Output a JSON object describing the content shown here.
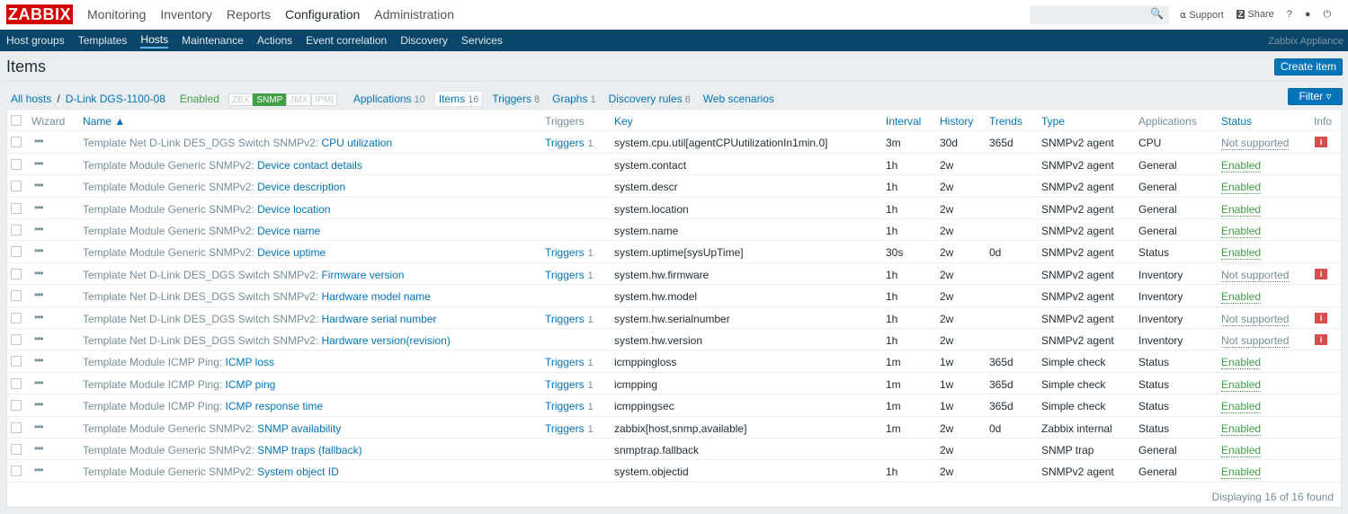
{
  "brand": "ZABBIX",
  "main_menu": [
    "Monitoring",
    "Inventory",
    "Reports",
    "Configuration",
    "Administration"
  ],
  "main_menu_active": 3,
  "top_links": {
    "support": "Support",
    "share": "Share",
    "help": "?"
  },
  "sub_menu": [
    "Host groups",
    "Templates",
    "Hosts",
    "Maintenance",
    "Actions",
    "Event correlation",
    "Discovery",
    "Services"
  ],
  "sub_menu_active": 2,
  "appliance": "Zabbix Appliance",
  "page_title": "Items",
  "create_button": "Create item",
  "filter_button": "Filter",
  "breadcrumb": {
    "all_hosts": "All hosts",
    "sep": "/",
    "host": "D-Link DGS-1100-08",
    "status": "Enabled"
  },
  "availability": [
    {
      "label": "ZBX",
      "on": false
    },
    {
      "label": "SNMP",
      "on": true
    },
    {
      "label": "JMX",
      "on": false
    },
    {
      "label": "IPMI",
      "on": false
    }
  ],
  "host_tabs": [
    {
      "label": "Applications",
      "count": "10"
    },
    {
      "label": "Items",
      "count": "16",
      "active": true
    },
    {
      "label": "Triggers",
      "count": "8"
    },
    {
      "label": "Graphs",
      "count": "1"
    },
    {
      "label": "Discovery rules",
      "count": "6"
    },
    {
      "label": "Web scenarios",
      "count": ""
    }
  ],
  "columns": {
    "wizard": "Wizard",
    "name": "Name ▲",
    "triggers": "Triggers",
    "key": "Key",
    "interval": "Interval",
    "history": "History",
    "trends": "Trends",
    "type": "Type",
    "applications": "Applications",
    "status": "Status",
    "info": "Info"
  },
  "rows": [
    [
      "Template Net D-Link DES_DGS Switch SNMPv2:",
      "CPU utilization",
      "1",
      "system.cpu.util[agentCPUutilizationIn1min.0]",
      "3m",
      "30d",
      "365d",
      "SNMPv2 agent",
      "CPU",
      "Not supported"
    ],
    [
      "Template Module Generic SNMPv2:",
      "Device contact details",
      "",
      "system.contact",
      "1h",
      "2w",
      "",
      "SNMPv2 agent",
      "General",
      "Enabled"
    ],
    [
      "Template Module Generic SNMPv2:",
      "Device description",
      "",
      "system.descr",
      "1h",
      "2w",
      "",
      "SNMPv2 agent",
      "General",
      "Enabled"
    ],
    [
      "Template Module Generic SNMPv2:",
      "Device location",
      "",
      "system.location",
      "1h",
      "2w",
      "",
      "SNMPv2 agent",
      "General",
      "Enabled"
    ],
    [
      "Template Module Generic SNMPv2:",
      "Device name",
      "",
      "system.name",
      "1h",
      "2w",
      "",
      "SNMPv2 agent",
      "General",
      "Enabled"
    ],
    [
      "Template Module Generic SNMPv2:",
      "Device uptime",
      "1",
      "system.uptime[sysUpTime]",
      "30s",
      "2w",
      "0d",
      "SNMPv2 agent",
      "Status",
      "Enabled"
    ],
    [
      "Template Net D-Link DES_DGS Switch SNMPv2:",
      "Firmware version",
      "1",
      "system.hw.firmware",
      "1h",
      "2w",
      "",
      "SNMPv2 agent",
      "Inventory",
      "Not supported"
    ],
    [
      "Template Net D-Link DES_DGS Switch SNMPv2:",
      "Hardware model name",
      "",
      "system.hw.model",
      "1h",
      "2w",
      "",
      "SNMPv2 agent",
      "Inventory",
      "Enabled"
    ],
    [
      "Template Net D-Link DES_DGS Switch SNMPv2:",
      "Hardware serial number",
      "1",
      "system.hw.serialnumber",
      "1h",
      "2w",
      "",
      "SNMPv2 agent",
      "Inventory",
      "Not supported"
    ],
    [
      "Template Net D-Link DES_DGS Switch SNMPv2:",
      "Hardware version(revision)",
      "",
      "system.hw.version",
      "1h",
      "2w",
      "",
      "SNMPv2 agent",
      "Inventory",
      "Not supported"
    ],
    [
      "Template Module ICMP Ping:",
      "ICMP loss",
      "1",
      "icmppingloss",
      "1m",
      "1w",
      "365d",
      "Simple check",
      "Status",
      "Enabled"
    ],
    [
      "Template Module ICMP Ping:",
      "ICMP ping",
      "1",
      "icmpping",
      "1m",
      "1w",
      "365d",
      "Simple check",
      "Status",
      "Enabled"
    ],
    [
      "Template Module ICMP Ping:",
      "ICMP response time",
      "1",
      "icmppingsec",
      "1m",
      "1w",
      "365d",
      "Simple check",
      "Status",
      "Enabled"
    ],
    [
      "Template Module Generic SNMPv2:",
      "SNMP availability",
      "1",
      "zabbix[host,snmp,available]",
      "1m",
      "2w",
      "0d",
      "Zabbix internal",
      "Status",
      "Enabled"
    ],
    [
      "Template Module Generic SNMPv2:",
      "SNMP traps (fallback)",
      "",
      "snmptrap.fallback",
      "",
      "2w",
      "",
      "SNMP trap",
      "General",
      "Enabled"
    ],
    [
      "Template Module Generic SNMPv2:",
      "System object ID",
      "",
      "system.objectid",
      "1h",
      "2w",
      "",
      "SNMPv2 agent",
      "General",
      "Enabled"
    ]
  ],
  "triggers_label": "Triggers",
  "footer": "Displaying 16 of 16 found"
}
